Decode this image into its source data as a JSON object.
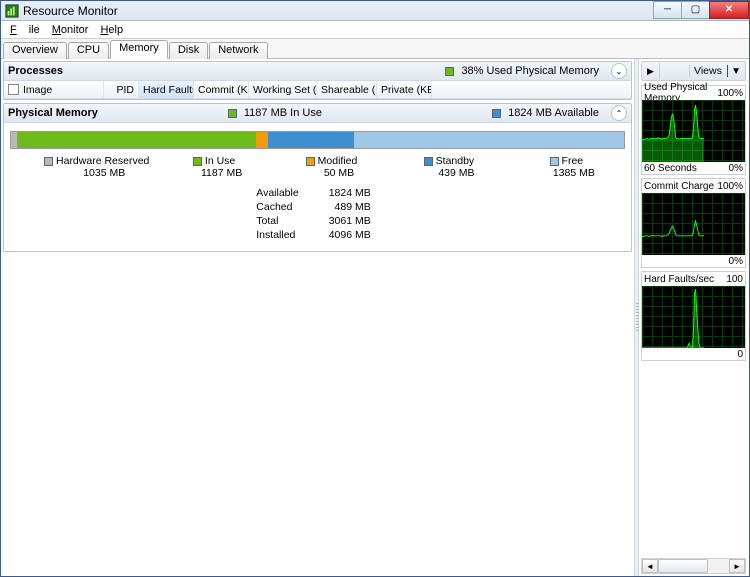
{
  "title": "Resource Monitor",
  "menu": {
    "file": "File",
    "monitor": "Monitor",
    "help": "Help"
  },
  "tabs": {
    "overview": "Overview",
    "cpu": "CPU",
    "memory": "Memory",
    "disk": "Disk",
    "network": "Network"
  },
  "processes": {
    "title": "Processes",
    "summary": "38% Used Physical Memory",
    "cols": {
      "image": "Image",
      "pid": "PID",
      "hard": "Hard Faults...",
      "commit": "Commit (KB)",
      "working": "Working Set (K...",
      "shareable": "Shareable (KB)",
      "private": "Private (KB)"
    }
  },
  "phys": {
    "title": "Physical Memory",
    "inuse_label": "1187 MB In Use",
    "avail_label": "1824 MB Available",
    "legend": {
      "hw": "Hardware Reserved",
      "hw_v": "1035 MB",
      "inuse": "In Use",
      "inuse_v": "1187 MB",
      "mod": "Modified",
      "mod_v": "50 MB",
      "stand": "Standby",
      "stand_v": "439 MB",
      "free": "Free",
      "free_v": "1385 MB"
    },
    "stats": {
      "available_l": "Available",
      "available_v": "1824 MB",
      "cached_l": "Cached",
      "cached_v": "489 MB",
      "total_l": "Total",
      "total_v": "3061 MB",
      "installed_l": "Installed",
      "installed_v": "4096 MB"
    }
  },
  "right": {
    "views": "Views",
    "chart1_title": "Used Physical Memory",
    "chart1_max": "100%",
    "chart1_footL": "60 Seconds",
    "chart1_footR": "0%",
    "chart2_title": "Commit Charge",
    "chart2_max": "100%",
    "chart2_footR": "0%",
    "chart3_title": "Hard Faults/sec",
    "chart3_max": "100",
    "chart3_footR": "0"
  },
  "colors": {
    "hw": "#b9b9b9",
    "inuse": "#6cbb1a",
    "mod": "#f59a0b",
    "stand": "#3f8ed4",
    "free": "#9ec7e8"
  },
  "chart_data": [
    {
      "type": "area",
      "title": "Used Physical Memory",
      "ylim": [
        0,
        100
      ],
      "x_seconds": 60,
      "baseline_pct": 38,
      "values": [
        36,
        36,
        37,
        37,
        37,
        38,
        37,
        37,
        38,
        38,
        38,
        38,
        38,
        38,
        38,
        39,
        38,
        38,
        38,
        37,
        38,
        38,
        38,
        38,
        39,
        40,
        45,
        60,
        72,
        78,
        70,
        58,
        40,
        38,
        38,
        37,
        37,
        38,
        38,
        38,
        38,
        38,
        38,
        38,
        38,
        38,
        38,
        38,
        39,
        55,
        85,
        92,
        78,
        60,
        40,
        38,
        38,
        38,
        38,
        38
      ]
    },
    {
      "type": "line",
      "title": "Commit Charge",
      "ylim": [
        0,
        100
      ],
      "x_seconds": 60,
      "values": [
        30,
        30,
        30,
        31,
        31,
        31,
        30,
        30,
        31,
        31,
        32,
        31,
        31,
        31,
        31,
        31,
        31,
        31,
        31,
        30,
        31,
        31,
        31,
        31,
        32,
        33,
        36,
        40,
        44,
        46,
        43,
        39,
        33,
        31,
        31,
        31,
        31,
        31,
        31,
        31,
        31,
        31,
        31,
        31,
        31,
        31,
        31,
        31,
        32,
        38,
        50,
        55,
        48,
        40,
        33,
        31,
        31,
        31,
        31,
        31
      ]
    },
    {
      "type": "area",
      "title": "Hard Faults/sec",
      "ylim": [
        0,
        100
      ],
      "x_seconds": 60,
      "values": [
        0,
        0,
        0,
        0,
        0,
        0,
        0,
        0,
        0,
        0,
        0,
        0,
        0,
        0,
        0,
        0,
        0,
        0,
        0,
        0,
        0,
        0,
        0,
        0,
        0,
        0,
        0,
        0,
        0,
        0,
        0,
        0,
        0,
        0,
        0,
        0,
        0,
        0,
        0,
        0,
        0,
        0,
        0,
        0,
        5,
        8,
        2,
        0,
        0,
        30,
        88,
        95,
        62,
        35,
        10,
        2,
        0,
        0,
        0,
        0
      ]
    }
  ],
  "bar_segments": [
    {
      "key": "hw",
      "pct": 1
    },
    {
      "key": "inuse",
      "pct": 39
    },
    {
      "key": "mod",
      "pct": 2
    },
    {
      "key": "stand",
      "pct": 14
    },
    {
      "key": "free",
      "pct": 44
    }
  ]
}
